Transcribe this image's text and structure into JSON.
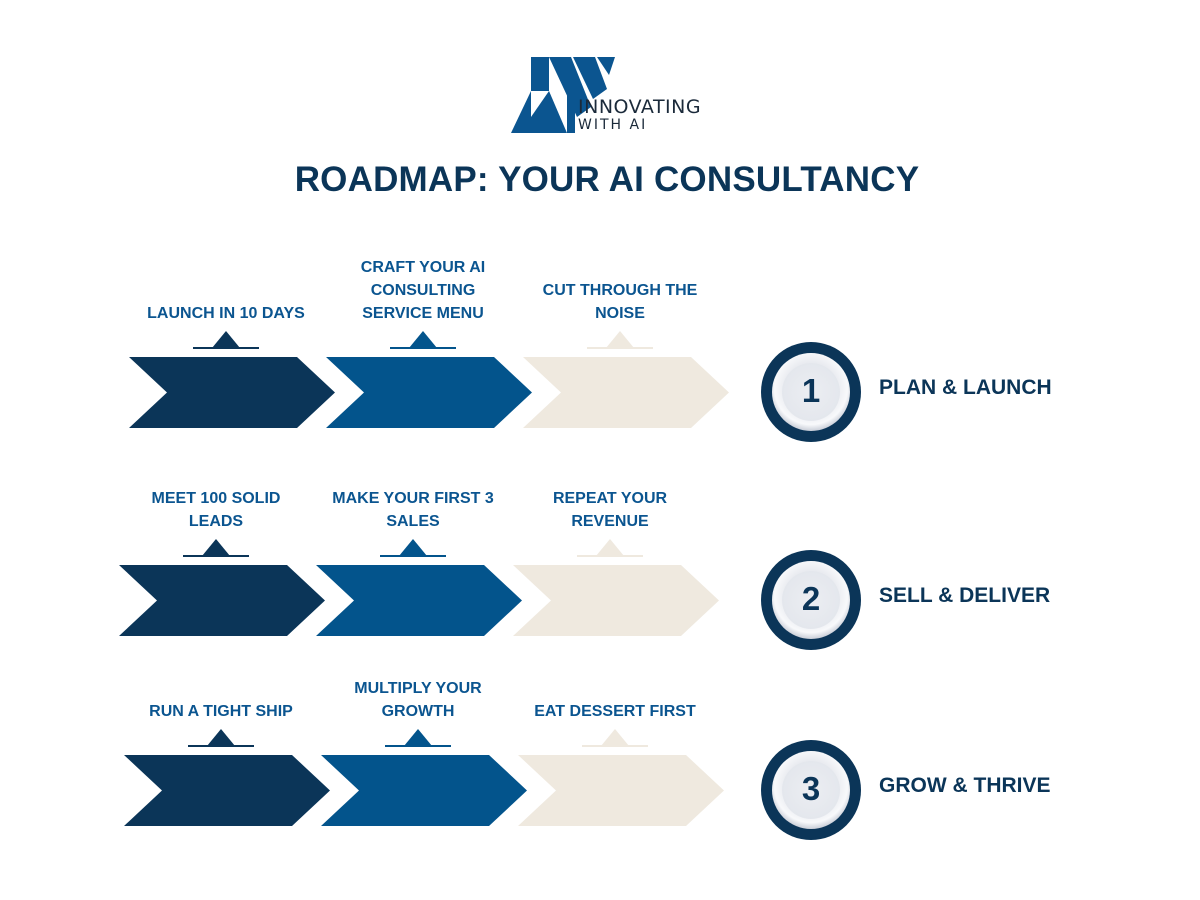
{
  "logo": {
    "line1": "INNOVATING",
    "line2": "WITH AI"
  },
  "title": "ROADMAP: YOUR AI CONSULTANCY",
  "colors": {
    "dark_navy": "#0b3558",
    "blue": "#03548c",
    "cream": "#efe9df",
    "label_blue": "#0b5590"
  },
  "phases": [
    {
      "number": "1",
      "name": "PLAN & LAUNCH",
      "steps": [
        {
          "label": "LAUNCH IN 10 DAYS",
          "color": "dark_navy"
        },
        {
          "label": "CRAFT YOUR AI CONSULTING SERVICE MENU",
          "color": "blue"
        },
        {
          "label": "CUT THROUGH THE NOISE",
          "color": "cream"
        }
      ]
    },
    {
      "number": "2",
      "name": "SELL & DELIVER",
      "steps": [
        {
          "label": "MEET 100 SOLID LEADS",
          "color": "dark_navy"
        },
        {
          "label": "MAKE YOUR FIRST 3 SALES",
          "color": "blue"
        },
        {
          "label": "REPEAT YOUR REVENUE",
          "color": "cream"
        }
      ]
    },
    {
      "number": "3",
      "name": "GROW & THRIVE",
      "steps": [
        {
          "label": "RUN A TIGHT SHIP",
          "color": "dark_navy"
        },
        {
          "label": "MULTIPLY YOUR GROWTH",
          "color": "blue"
        },
        {
          "label": "EAT DESSERT FIRST",
          "color": "cream"
        }
      ]
    }
  ]
}
